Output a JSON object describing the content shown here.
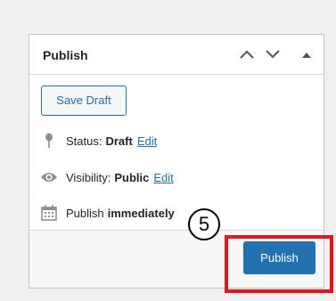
{
  "panel": {
    "title": "Publish"
  },
  "actions": {
    "save_draft_label": "Save Draft",
    "publish_label": "Publish"
  },
  "status": {
    "label": "Status:",
    "value": "Draft",
    "edit_label": "Edit"
  },
  "visibility": {
    "label": "Visibility:",
    "value": "Public",
    "edit_label": "Edit"
  },
  "schedule": {
    "label": "Publish",
    "value": "immediately"
  },
  "annotation": {
    "step_number": "5",
    "highlight_color": "#e8141c"
  },
  "colors": {
    "accent": "#2271b1",
    "panel_bg": "#ffffff",
    "page_bg": "#f0f0f1"
  },
  "icons": {
    "move_up": "chevron-up-icon",
    "move_down": "chevron-down-icon",
    "toggle": "triangle-up-icon",
    "status": "pin-icon",
    "visibility": "eye-icon",
    "schedule": "calendar-icon"
  }
}
